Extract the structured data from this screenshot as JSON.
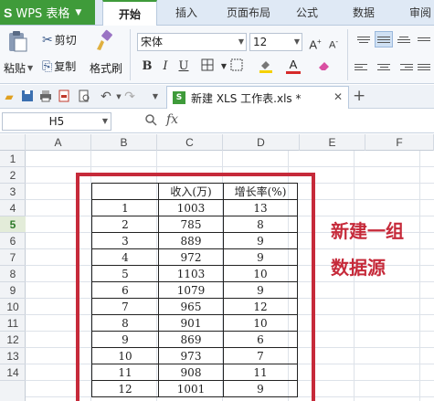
{
  "app": {
    "logo": "S",
    "title": "WPS 表格"
  },
  "ribbon_tabs": [
    {
      "label": "开始",
      "active": true
    },
    {
      "label": "插入"
    },
    {
      "label": "页面布局"
    },
    {
      "label": "公式"
    },
    {
      "label": "数据"
    },
    {
      "label": "审阅"
    }
  ],
  "clipboard": {
    "paste": "粘贴",
    "cut": "剪切",
    "copy": "复制",
    "format_painter": "格式刷"
  },
  "font": {
    "name": "宋体",
    "size": "12"
  },
  "format_buttons": {
    "bold": "B",
    "italic": "I",
    "underline": "U"
  },
  "colors": {
    "accent": "#3f9b3a",
    "highlight": "#c62a3a",
    "fill_bar": "#f5d100",
    "font_bar": "#d62a2a"
  },
  "document_tab": {
    "name": "新建 XLS 工作表.xls *",
    "icon": "xls-file-icon"
  },
  "formula_bar": {
    "cell_ref": "H5",
    "fx": "fx",
    "content": ""
  },
  "columns": [
    "A",
    "B",
    "C",
    "D",
    "E",
    "F"
  ],
  "rows": [
    "1",
    "2",
    "3",
    "4",
    "5",
    "6",
    "7",
    "8",
    "9",
    "10",
    "11",
    "12",
    "13",
    "14"
  ],
  "selected_row": "5",
  "table": {
    "headers": [
      "",
      "收入(万)",
      "增长率(%)"
    ],
    "rows": [
      [
        "1",
        "1003",
        "13"
      ],
      [
        "2",
        "785",
        "8"
      ],
      [
        "3",
        "889",
        "9"
      ],
      [
        "4",
        "972",
        "9"
      ],
      [
        "5",
        "1103",
        "10"
      ],
      [
        "6",
        "1079",
        "9"
      ],
      [
        "7",
        "965",
        "12"
      ],
      [
        "8",
        "901",
        "10"
      ],
      [
        "9",
        "869",
        "6"
      ],
      [
        "10",
        "973",
        "7"
      ],
      [
        "11",
        "908",
        "11"
      ],
      [
        "12",
        "1001",
        "9"
      ]
    ]
  },
  "annotation": {
    "line1": "新建一组",
    "line2": "数据源"
  }
}
